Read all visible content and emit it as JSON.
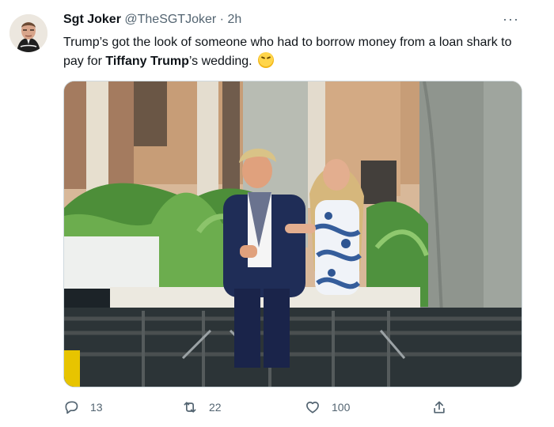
{
  "author": {
    "name": "Sgt Joker",
    "handle": "@TheSGTJoker",
    "separator": "·",
    "time": "2h"
  },
  "tweet": {
    "text_before": "Trump’s got the look of someone who had to borrow money from a loan shark to pay for ",
    "bold_name": "Tiffany Trump",
    "text_after": "’s wedding. ",
    "emoji": "face-with-tears-of-joy-emoji"
  },
  "more_label": "···",
  "actions": {
    "reply_count": "13",
    "retweet_count": "22",
    "like_count": "100",
    "share_icon": "share-icon"
  },
  "colors": {
    "text": "#0f1419",
    "muted": "#536471",
    "border": "#cfd9de"
  }
}
